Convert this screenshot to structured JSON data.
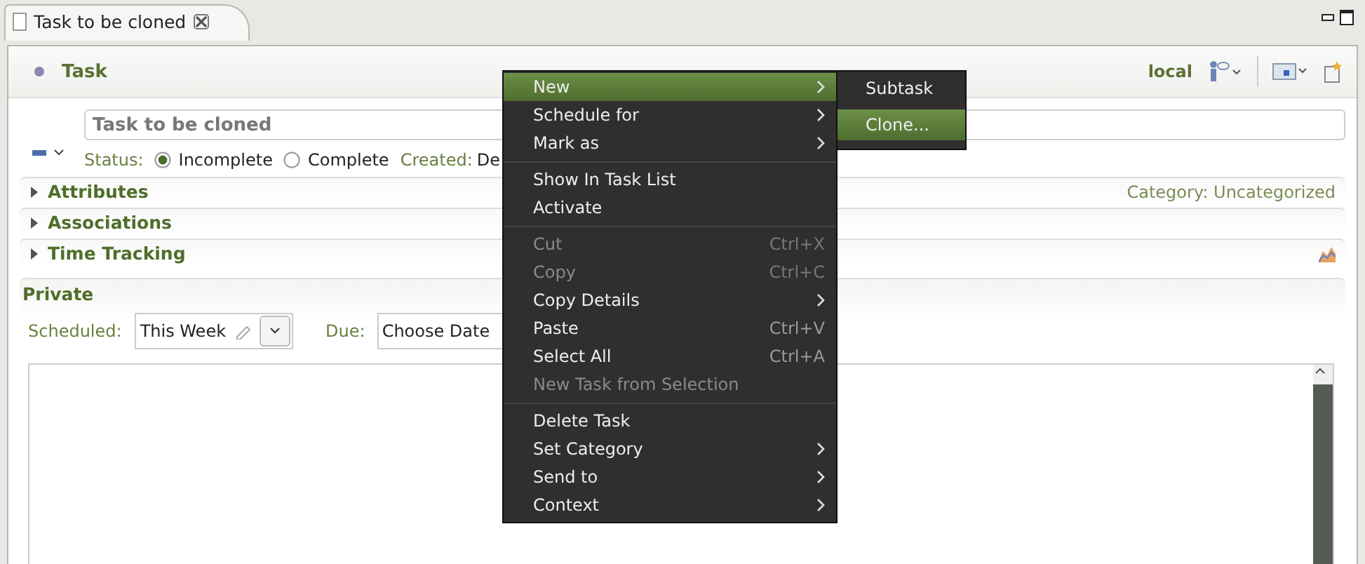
{
  "editor_tab": {
    "title": "Task to be cloned",
    "selected": true
  },
  "header": {
    "title": "Task",
    "repository": "local"
  },
  "summary": {
    "value": "Task to be cloned"
  },
  "status": {
    "label": "Status:",
    "options": [
      {
        "label": "Incomplete",
        "selected": true
      },
      {
        "label": "Complete",
        "selected": false
      }
    ],
    "created_label": "Created:",
    "created_value": "De"
  },
  "sections": [
    {
      "title": "Attributes",
      "expanded": false,
      "info": "Category: Uncategorized"
    },
    {
      "title": "Associations",
      "expanded": false
    },
    {
      "title": "Time Tracking",
      "expanded": false
    }
  ],
  "private": {
    "title": "Private",
    "scheduled_label": "Scheduled:",
    "scheduled_value": "This Week",
    "due_label": "Due:",
    "due_value": "Choose Date"
  },
  "context_menu": {
    "items": [
      {
        "kind": "item",
        "label": "New",
        "submenu": true,
        "selected": true,
        "disabled": false
      },
      {
        "kind": "item",
        "label": "Schedule for",
        "submenu": true,
        "selected": false,
        "disabled": false
      },
      {
        "kind": "item",
        "label": "Mark as",
        "submenu": true,
        "selected": false,
        "disabled": false
      },
      {
        "kind": "separator"
      },
      {
        "kind": "item",
        "label": "Show In Task List",
        "submenu": false,
        "selected": false,
        "disabled": false
      },
      {
        "kind": "item",
        "label": "Activate",
        "submenu": false,
        "selected": false,
        "disabled": false
      },
      {
        "kind": "separator"
      },
      {
        "kind": "item",
        "label": "Cut",
        "shortcut": "Ctrl+X",
        "submenu": false,
        "selected": false,
        "disabled": true
      },
      {
        "kind": "item",
        "label": "Copy",
        "shortcut": "Ctrl+C",
        "submenu": false,
        "selected": false,
        "disabled": true
      },
      {
        "kind": "item",
        "label": "Copy Details",
        "submenu": true,
        "selected": false,
        "disabled": false
      },
      {
        "kind": "item",
        "label": "Paste",
        "shortcut": "Ctrl+V",
        "submenu": false,
        "selected": false,
        "disabled": false
      },
      {
        "kind": "item",
        "label": "Select All",
        "shortcut": "Ctrl+A",
        "submenu": false,
        "selected": false,
        "disabled": false
      },
      {
        "kind": "item",
        "label": "New Task from Selection",
        "submenu": false,
        "selected": false,
        "disabled": true
      },
      {
        "kind": "separator"
      },
      {
        "kind": "item",
        "label": "Delete Task",
        "submenu": false,
        "selected": false,
        "disabled": false
      },
      {
        "kind": "item",
        "label": "Set Category",
        "submenu": true,
        "selected": false,
        "disabled": false
      },
      {
        "kind": "item",
        "label": "Send to",
        "submenu": true,
        "selected": false,
        "disabled": false
      },
      {
        "kind": "item",
        "label": "Context",
        "submenu": true,
        "selected": false,
        "disabled": false
      }
    ]
  },
  "submenu": {
    "items": [
      {
        "label": "Subtask",
        "selected": false
      },
      {
        "label": "Clone...",
        "selected": true
      }
    ]
  }
}
